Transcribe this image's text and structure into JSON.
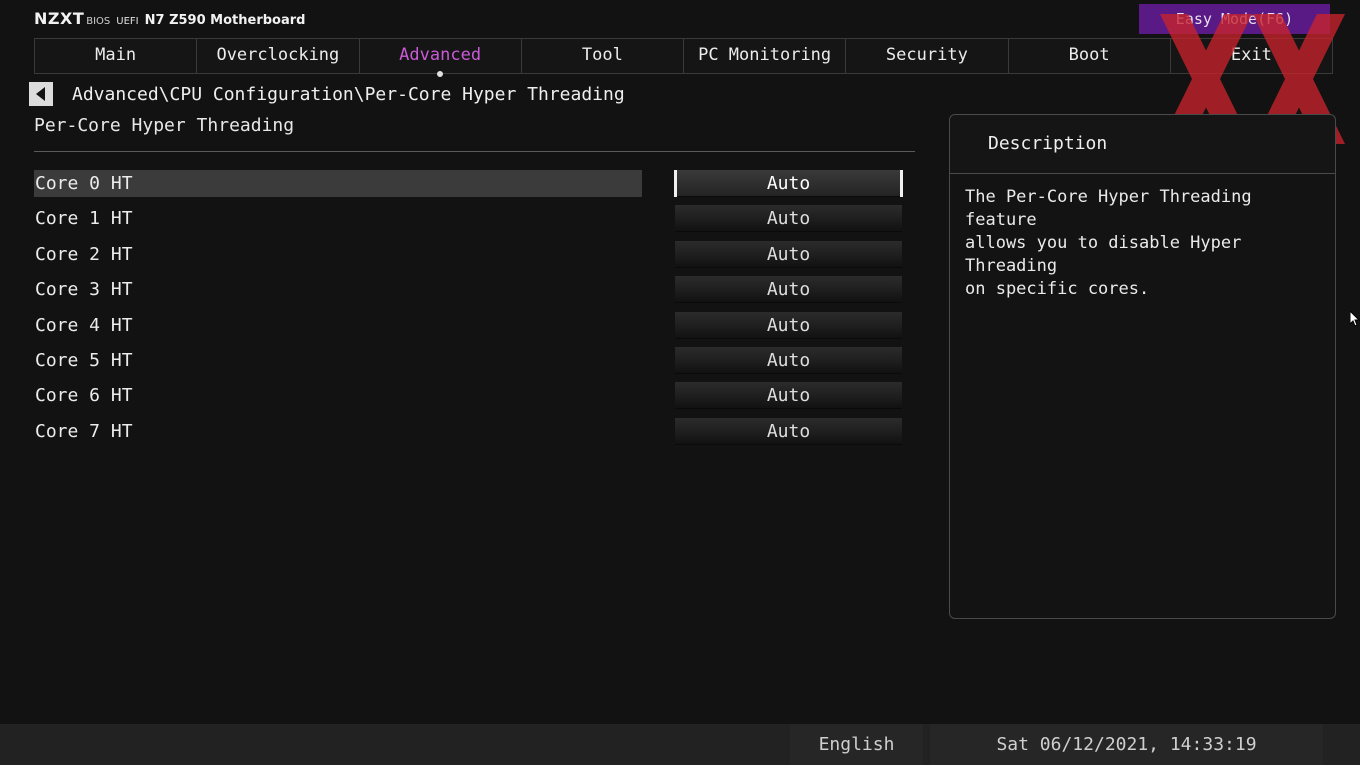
{
  "brand": {
    "logo": "NZXT",
    "bios": "BIOS",
    "uefi": "UEFI",
    "model": "N7 Z590 Motherboard"
  },
  "easy_mode_label": "Easy Mode(F6)",
  "tabs": [
    {
      "label": "Main"
    },
    {
      "label": "Overclocking"
    },
    {
      "label": "Advanced"
    },
    {
      "label": "Tool"
    },
    {
      "label": "PC Monitoring"
    },
    {
      "label": "Security"
    },
    {
      "label": "Boot"
    },
    {
      "label": "Exit"
    }
  ],
  "active_tab": "Advanced",
  "accent_color": "#c95bd8",
  "easy_mode_color": "#5a1a86",
  "breadcrumb": "Advanced\\CPU Configuration\\Per-Core Hyper Threading",
  "section_title": "Per-Core Hyper Threading",
  "settings": [
    {
      "label": "Core 0 HT",
      "value": "Auto"
    },
    {
      "label": "Core 1 HT",
      "value": "Auto"
    },
    {
      "label": "Core 2 HT",
      "value": "Auto"
    },
    {
      "label": "Core 3 HT",
      "value": "Auto"
    },
    {
      "label": "Core 4 HT",
      "value": "Auto"
    },
    {
      "label": "Core 5 HT",
      "value": "Auto"
    },
    {
      "label": "Core 6 HT",
      "value": "Auto"
    },
    {
      "label": "Core 7 HT",
      "value": "Auto"
    }
  ],
  "selected_setting": "Core 0 HT",
  "description": {
    "title": "Description",
    "text": "The Per-Core Hyper Threading feature\nallows you to disable Hyper Threading\non specific cores."
  },
  "footer": {
    "language": "English",
    "datetime": "Sat 06/12/2021, 14:33:19"
  },
  "icons": {
    "back": "back-arrow-icon",
    "watermark": "xx-watermark-icon",
    "cursor": "mouse-cursor-icon"
  }
}
